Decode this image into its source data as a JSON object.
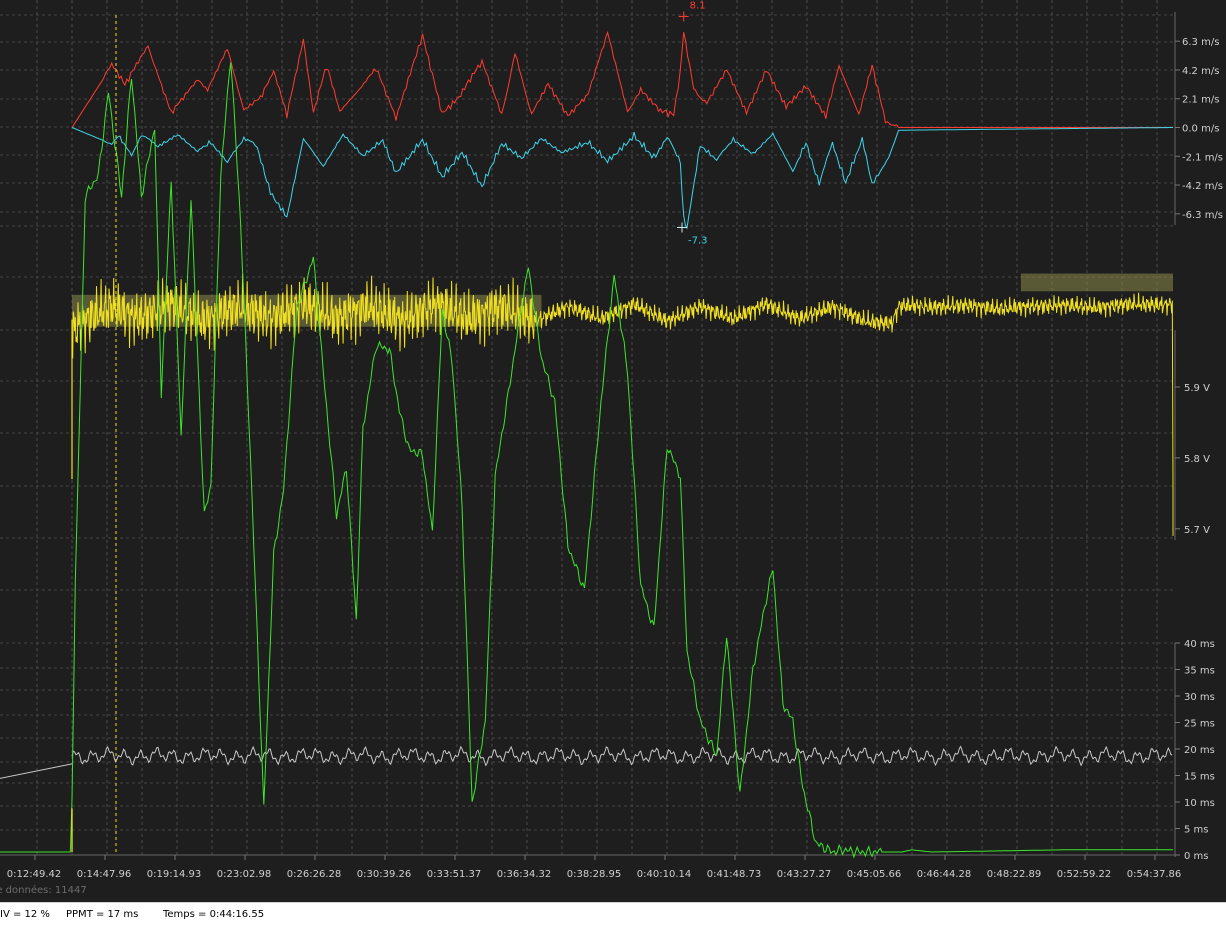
{
  "chart_data": [
    {
      "type": "line",
      "name": "vertical speed",
      "ylim": [
        -7.5,
        8.5
      ],
      "y_ticks": [
        "6.3 m/s",
        "4.2 m/s",
        "2.1 m/s",
        "0.0 m/s",
        "-2.1 m/s",
        "-4.2 m/s",
        "-6.3 m/s"
      ],
      "y_tick_values": [
        6.3,
        4.2,
        2.1,
        0.0,
        -2.1,
        -4.2,
        -6.3
      ],
      "max_label": "8.1",
      "min_label": "-7.3",
      "max_value": 8.1,
      "min_value": -7.3,
      "max_time": 1850,
      "min_time": 1845,
      "series": [
        {
          "color": "#ff3b30",
          "x": [
            0,
            120,
            160,
            230,
            300,
            380,
            410,
            470,
            520,
            570,
            610,
            650,
            700,
            730,
            770,
            810,
            870,
            920,
            980,
            1060,
            1120,
            1170,
            1240,
            1300,
            1340,
            1390,
            1440,
            1500,
            1560,
            1620,
            1680,
            1720,
            1780,
            1820,
            1840,
            1850,
            1880,
            1920,
            1980,
            2040,
            2100,
            2160,
            2220,
            2280,
            2320,
            2380,
            2420,
            2460,
            2500,
            3330
          ],
          "y": [
            0,
            4.5,
            2.8,
            5.9,
            0.8,
            3.4,
            2.6,
            5.6,
            1.2,
            1.9,
            4.1,
            0.6,
            6.3,
            0.9,
            4.2,
            1.1,
            2.8,
            4.1,
            0.5,
            6.4,
            0.7,
            1.9,
            4.6,
            0.8,
            5.3,
            0.9,
            2.9,
            0.6,
            2.2,
            6.8,
            1.1,
            2.5,
            0.9,
            0.7,
            3.8,
            6.8,
            2.7,
            1.6,
            4.0,
            0.8,
            3.9,
            1.2,
            2.7,
            0.5,
            4.5,
            0.9,
            4.2,
            0.3,
            0,
            0
          ]
        },
        {
          "color": "#3fd4e8",
          "x": [
            0,
            120,
            140,
            180,
            210,
            260,
            320,
            380,
            420,
            470,
            520,
            560,
            600,
            650,
            700,
            760,
            820,
            880,
            940,
            980,
            1060,
            1120,
            1180,
            1240,
            1300,
            1360,
            1420,
            1480,
            1560,
            1620,
            1700,
            1760,
            1800,
            1840,
            1850,
            1860,
            1900,
            1950,
            2000,
            2060,
            2120,
            2180,
            2220,
            2260,
            2300,
            2340,
            2390,
            2420,
            2470,
            2500,
            3330
          ],
          "y": [
            0,
            -1.2,
            -0.3,
            -2.0,
            -0.5,
            -1.2,
            -0.4,
            -1.7,
            -0.8,
            -2.5,
            -0.6,
            -1.3,
            -4.4,
            -6.3,
            -0.8,
            -2.8,
            -0.4,
            -1.9,
            -0.7,
            -3.0,
            -0.6,
            -3.3,
            -1.5,
            -4.0,
            -0.9,
            -2.0,
            -0.6,
            -1.7,
            -0.8,
            -2.2,
            -0.3,
            -1.9,
            -0.6,
            -2.3,
            -6.4,
            -7.3,
            -1.0,
            -2.3,
            -0.7,
            -1.8,
            -0.4,
            -3.2,
            -0.8,
            -3.9,
            -1.0,
            -3.7,
            -0.6,
            -3.9,
            -2.2,
            -0.2,
            0
          ]
        }
      ]
    },
    {
      "type": "line",
      "name": "voltage",
      "color": "#f0e020",
      "ylim": [
        5.66,
        6.12
      ],
      "y_ticks": [
        "5.9 V",
        "5.8 V",
        "5.7 V"
      ],
      "y_tick_values": [
        5.9,
        5.8,
        5.7
      ],
      "x": [
        0,
        60,
        120,
        200,
        300,
        400,
        500,
        600,
        700,
        800,
        900,
        1000,
        1100,
        1200,
        1300,
        1400,
        1500,
        1600,
        1700,
        1800,
        1900,
        2000,
        2100,
        2200,
        2300,
        2400,
        2480,
        2500,
        2540,
        2600,
        2700,
        2800,
        2900,
        3000,
        3100,
        3200,
        3300,
        3330
      ],
      "y": [
        5.93,
        5.99,
        6.03,
        5.98,
        6.04,
        5.97,
        6.03,
        5.98,
        6.04,
        5.98,
        6.03,
        5.97,
        6.04,
        5.98,
        6.03,
        5.97,
        6.03,
        5.98,
        6.04,
        5.97,
        6.03,
        5.98,
        6.04,
        5.98,
        6.03,
        5.97,
        5.96,
        6.03,
        6.035,
        6.025,
        6.035,
        6.02,
        6.03,
        6.035,
        6.025,
        6.04,
        6.035,
        6.04
      ]
    },
    {
      "type": "line",
      "name": "frame time",
      "color": "#c8c8c8",
      "ylim": [
        0,
        40
      ],
      "y_ticks": [
        "40 ms",
        "35 ms",
        "30 ms",
        "25 ms",
        "20 ms",
        "15 ms",
        "10 ms",
        "5 ms",
        "0 ms"
      ],
      "y_tick_values": [
        40,
        35,
        30,
        25,
        20,
        15,
        10,
        5,
        0
      ],
      "baseline": 18.7,
      "pre_start": [
        [
          -230,
          14.3
        ],
        [
          0,
          17.2
        ]
      ]
    },
    {
      "type": "line",
      "name": "altitude",
      "color": "#3ce62a",
      "note_units": "percent of bottom panel ms scale used as relative level",
      "x": [
        -230,
        -5,
        0,
        10,
        40,
        80,
        110,
        150,
        180,
        210,
        250,
        270,
        300,
        330,
        360,
        400,
        420,
        450,
        480,
        510,
        540,
        580,
        610,
        640,
        680,
        700,
        730,
        760,
        800,
        830,
        860,
        880,
        920,
        960,
        990,
        1020,
        1060,
        1090,
        1120,
        1150,
        1180,
        1210,
        1250,
        1280,
        1320,
        1350,
        1380,
        1420,
        1460,
        1500,
        1550,
        1600,
        1640,
        1680,
        1720,
        1760,
        1800,
        1840,
        1860,
        1900,
        1950,
        1980,
        2020,
        2060,
        2100,
        2120,
        2150,
        2180,
        2210,
        2250,
        2300,
        2330,
        2380,
        2410,
        2440,
        2470,
        2490,
        2510,
        2540,
        2600,
        3000,
        3330
      ],
      "y": [
        0,
        0,
        12,
        62,
        150,
        155,
        174,
        150,
        178,
        150,
        166,
        105,
        154,
        95,
        150,
        77,
        84,
        155,
        182,
        144,
        90,
        10,
        68,
        83,
        125,
        129,
        136,
        110,
        77,
        88,
        53,
        97,
        116,
        115,
        101,
        92,
        91,
        73,
        124,
        112,
        79,
        11,
        30,
        86,
        105,
        120,
        134,
        113,
        103,
        70,
        60,
        103,
        132,
        110,
        61,
        51,
        93,
        86,
        46,
        30,
        22,
        50,
        13,
        42,
        58,
        65,
        34,
        30,
        15,
        2,
        0,
        0.5,
        0,
        0,
        0,
        0,
        0,
        0,
        0.5,
        0,
        0.5,
        0.5
      ]
    },
    {
      "type": "line",
      "name": "x-axis",
      "x_ticks": [
        "0:12:49.42",
        "0:14:47.96",
        "0:19:14.93",
        "0:23:02.98",
        "0:26:26.28",
        "0:30:39.26",
        "0:33:51.37",
        "0:36:34.32",
        "0:38:28.95",
        "0:40:10.14",
        "0:41:48.73",
        "0:43:27.27",
        "0:45:05.66",
        "0:46:44.28",
        "0:48:22.89",
        "0:52:59.22",
        "0:54:37.86"
      ],
      "cursor_time": "0:14:47.96",
      "data_count_label": "de données: 11447"
    }
  ],
  "status": {
    "iv": "IV = 12 %",
    "ppmt": "PPMT = 17 ms",
    "temps": "Temps = 0:44:16.55"
  }
}
